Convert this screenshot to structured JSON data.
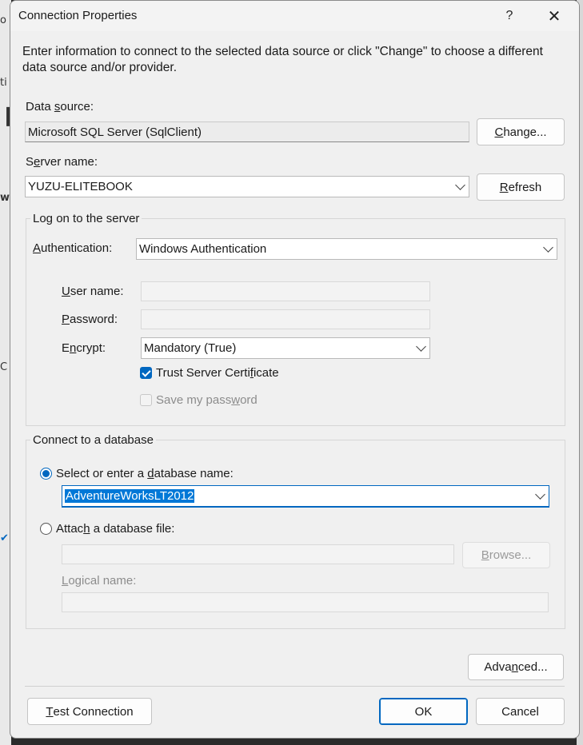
{
  "background": {
    "letters": [
      "o",
      "ti",
      "❙",
      "w",
      "C",
      "✔"
    ]
  },
  "titlebar": {
    "title": "Connection Properties",
    "help": "?",
    "close": "✕"
  },
  "intro": "Enter information to connect to the selected data source or click \"Change\" to choose a different data source and/or provider.",
  "data_source": {
    "label_pre": "Data ",
    "label_key": "s",
    "label_post": "ource:",
    "value": "Microsoft SQL Server (SqlClient)",
    "change_pre": "",
    "change_key": "C",
    "change_post": "hange..."
  },
  "server": {
    "label_pre": "S",
    "label_key": "e",
    "label_post": "rver name:",
    "value": "YUZU-ELITEBOOK",
    "refresh_pre": "",
    "refresh_key": "R",
    "refresh_post": "efresh"
  },
  "logon": {
    "group_title": "Log on to the server",
    "auth_label_pre": "",
    "auth_label_key": "A",
    "auth_label_post": "uthentication:",
    "auth_value": "Windows Authentication",
    "user_label_pre": "",
    "user_label_key": "U",
    "user_label_post": "ser name:",
    "pass_label_pre": "",
    "pass_label_key": "P",
    "pass_label_post": "assword:",
    "encrypt_label_pre": "E",
    "encrypt_label_key": "n",
    "encrypt_label_post": "crypt:",
    "encrypt_value": "Mandatory (True)",
    "trust_pre": "Trust Server Certi",
    "trust_key": "f",
    "trust_post": "icate",
    "trust_checked": true,
    "save_pre": "Save my pass",
    "save_key": "w",
    "save_post": "ord",
    "save_checked": false
  },
  "database": {
    "group_title": "Connect to a database",
    "select_pre": "Select or enter a ",
    "select_key": "d",
    "select_post": "atabase name:",
    "db_value": "AdventureWorksLT2012",
    "attach_pre": "Attac",
    "attach_key": "h",
    "attach_post": " a database file:",
    "browse_pre": "",
    "browse_key": "B",
    "browse_post": "rowse...",
    "logical_pre": "",
    "logical_key": "L",
    "logical_post": "ogical name:"
  },
  "buttons": {
    "advanced_pre": "Adva",
    "advanced_key": "n",
    "advanced_post": "ced...",
    "test_pre": "",
    "test_key": "T",
    "test_post": "est Connection",
    "ok": "OK",
    "cancel": "Cancel"
  },
  "colors": {
    "accent": "#0067c0",
    "selection": "#0078d7",
    "dialog_bg": "#f0f0f0"
  }
}
